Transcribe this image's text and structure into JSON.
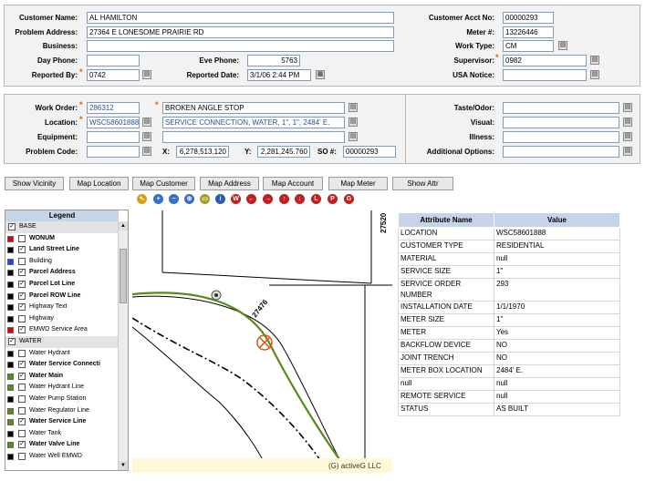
{
  "top": {
    "customer_name_label": "Customer Name:",
    "customer_name": "AL HAMILTON",
    "problem_address_label": "Problem Address:",
    "problem_address": "27364 E LONESOME PRAIRIE RD",
    "business_label": "Business:",
    "business": "",
    "day_phone_label": "Day Phone:",
    "day_phone": "",
    "eve_phone_label": "Eve Phone:",
    "eve_phone": "5763",
    "reported_by_label": "Reported By:",
    "reported_by": "0742",
    "reported_date_label": "Reported Date:",
    "reported_date": "3/1/06 2:44 PM",
    "acct_label": "Customer Acct No:",
    "acct": "00000293",
    "meter_label": "Meter #:",
    "meter": "13226446",
    "work_type_label": "Work Type:",
    "work_type": "CM",
    "supervisor_label": "Supervisor:",
    "supervisor": "0982",
    "usa_label": "USA Notice:",
    "usa": ""
  },
  "work": {
    "work_order_label": "Work Order:",
    "work_order": "286312",
    "description": "BROKEN ANGLE STOP",
    "location_label": "Location:",
    "location": "WSC58601888",
    "location_desc": "SERVICE CONNECTION, WATER, 1\", 1\", 2484' E.",
    "equipment_label": "Equipment:",
    "equipment": "",
    "problem_code_label": "Problem Code:",
    "problem_code": "",
    "x_label": "X:",
    "x": "6,278,513.120",
    "y_label": "Y:",
    "y": "2,281,245.760",
    "so_label": "SO #:",
    "so": "00000293",
    "taste_label": "Taste/Odor:",
    "visual_label": "Visual:",
    "illness_label": "Illness:",
    "options_label": "Additional Options:"
  },
  "buttons": [
    "Show Vicinity",
    "Map Location",
    "Map Customer",
    "Map Address",
    "Map Account",
    "Map Meter",
    "Show Attr"
  ],
  "toolbar_icons": [
    "select-icon",
    "zoom-in-icon",
    "zoom-out-icon",
    "zoom-full-icon",
    "ruler-icon",
    "info-icon",
    "web-icon",
    "pan-left-icon",
    "pan-right-icon",
    "pan-up-icon",
    "pan-down-icon",
    "label-icon",
    "print-icon",
    "go-icon"
  ],
  "toolbar_glyphs": [
    "↖",
    "+",
    "−",
    "⊕",
    "▭",
    "i",
    "W",
    "←",
    "→",
    "↑",
    "↓",
    "L",
    "P",
    "G"
  ],
  "toolbar_colors": [
    "#d4a017",
    "#3a6fc7",
    "#3a6fc7",
    "#3a6fc7",
    "#a0a020",
    "#2a5db0",
    "#c02020",
    "#c02020",
    "#c02020",
    "#c02020",
    "#c02020",
    "#c02020",
    "#c02020",
    "#c02020"
  ],
  "legend": {
    "title": "Legend",
    "groups": [
      {
        "name": "BASE",
        "items": [
          {
            "label": "WONUM",
            "color": "#e00000",
            "checked": false,
            "bold": true
          },
          {
            "label": "Land Street Line",
            "color": "#000000",
            "checked": true,
            "bold": true
          },
          {
            "label": "Building",
            "color": "#2040ff",
            "checked": false,
            "bold": false
          },
          {
            "label": "Parcel Address",
            "color": "#000000",
            "checked": true,
            "bold": true
          },
          {
            "label": "Parcel Lot Line",
            "color": "#000000",
            "checked": true,
            "bold": true
          },
          {
            "label": "Parcel ROW Line",
            "color": "#000000",
            "checked": true,
            "bold": true
          },
          {
            "label": "Highway Text",
            "color": "#000000",
            "checked": true,
            "bold": false
          },
          {
            "label": "Highway",
            "color": "#000000",
            "checked": false,
            "bold": false
          },
          {
            "label": "EMWD Service Area",
            "color": "#e00000",
            "checked": true,
            "bold": false
          }
        ]
      },
      {
        "name": "WATER",
        "items": [
          {
            "label": "Water Hydrant",
            "color": "#000000",
            "checked": false,
            "bold": false
          },
          {
            "label": "Water Service Connecti",
            "color": "#000000",
            "checked": true,
            "bold": true
          },
          {
            "label": "Water Main",
            "color": "#5a8a1a",
            "checked": true,
            "bold": true
          },
          {
            "label": "Water Hydrant Line",
            "color": "#5a8a1a",
            "checked": false,
            "bold": false
          },
          {
            "label": "Water Pump Station",
            "color": "#000000",
            "checked": false,
            "bold": false
          },
          {
            "label": "Water Regulator Line",
            "color": "#5a8a1a",
            "checked": false,
            "bold": false
          },
          {
            "label": "Water Service Line",
            "color": "#5a8a1a",
            "checked": true,
            "bold": true
          },
          {
            "label": "Water Tank",
            "color": "#000000",
            "checked": false,
            "bold": false
          },
          {
            "label": "Water Valve Line",
            "color": "#5a8a1a",
            "checked": true,
            "bold": true
          },
          {
            "label": "Water Well EMWD",
            "color": "#000000",
            "checked": false,
            "bold": false
          }
        ]
      }
    ]
  },
  "map": {
    "label_27520": "27520",
    "label_27476": "27476",
    "copyright": "(G) activeG LLC"
  },
  "attributes": {
    "header_name": "Attribute Name",
    "header_value": "Value",
    "rows": [
      [
        "LOCATION",
        "WSC58601888"
      ],
      [
        "CUSTOMER TYPE",
        "RESIDENTIAL"
      ],
      [
        "MATERIAL",
        "null"
      ],
      [
        "SERVICE SIZE",
        "1\""
      ],
      [
        "SERVICE ORDER NUMBER",
        "293"
      ],
      [
        "INSTALLATION DATE",
        "1/1/1970"
      ],
      [
        "METER SIZE",
        "1\""
      ],
      [
        "METER",
        "Yes"
      ],
      [
        "BACKFLOW DEVICE",
        "NO"
      ],
      [
        "JOINT TRENCH",
        "NO"
      ],
      [
        "METER BOX LOCATION",
        "2484' E."
      ],
      [
        "null",
        "null"
      ],
      [
        "REMOTE SERVICE",
        "null"
      ],
      [
        "STATUS",
        "AS BUILT"
      ]
    ]
  }
}
